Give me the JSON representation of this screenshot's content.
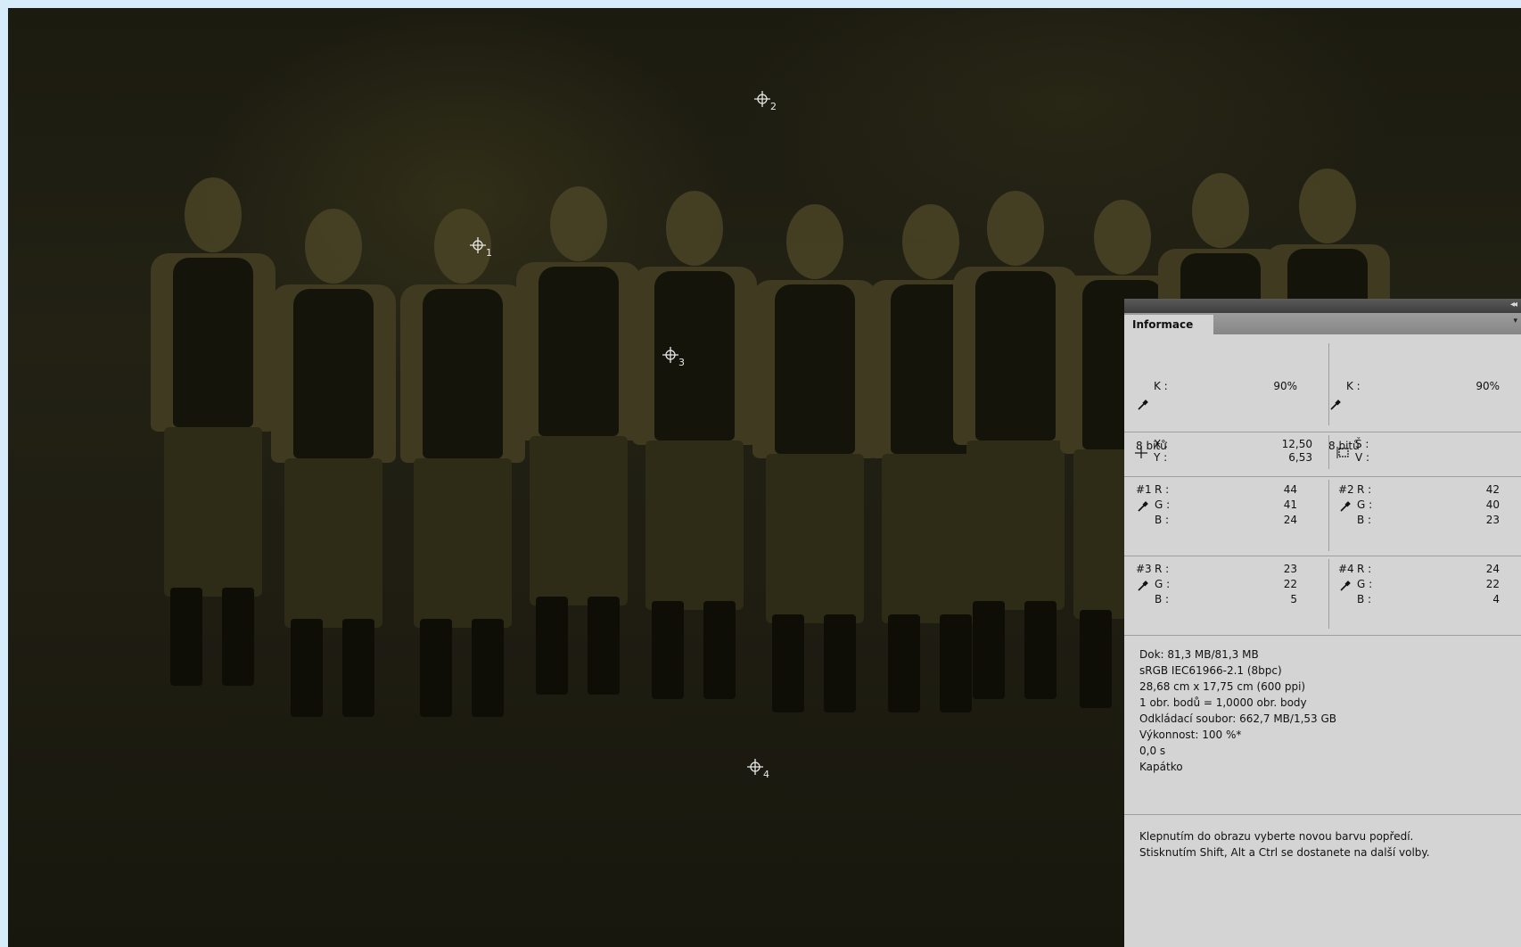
{
  "canvas": {
    "markers": [
      {
        "id": "1",
        "label": "1"
      },
      {
        "id": "2",
        "label": "2"
      },
      {
        "id": "3",
        "label": "3"
      },
      {
        "id": "4",
        "label": "4"
      }
    ]
  },
  "panel": {
    "tab_label": "Informace",
    "collapse_glyph": "◂◂",
    "menu_glyph": "▾",
    "k_left": {
      "label": "K :",
      "value": "90%",
      "bits": "8 bitů"
    },
    "k_right": {
      "label": "K :",
      "value": "90%",
      "bits": "8 bitů"
    },
    "coords": {
      "x_label": "X :",
      "y_label": "Y :",
      "x_value": "12,50",
      "y_value": "6,53",
      "w_label": "Š :",
      "h_label": "V :"
    },
    "samplers": [
      {
        "prefix": "#1",
        "r_label": "R :",
        "g_label": "G :",
        "b_label": "B :",
        "r": "44",
        "g": "41",
        "b": "24"
      },
      {
        "prefix": "#2",
        "r_label": "R :",
        "g_label": "G :",
        "b_label": "B :",
        "r": "42",
        "g": "40",
        "b": "23"
      },
      {
        "prefix": "#3",
        "r_label": "R :",
        "g_label": "G :",
        "b_label": "B :",
        "r": "23",
        "g": "22",
        "b": "5"
      },
      {
        "prefix": "#4",
        "r_label": "R :",
        "g_label": "G :",
        "b_label": "B :",
        "r": "24",
        "g": "22",
        "b": "4"
      }
    ],
    "doc_info": [
      "Dok: 81,3 MB/81,3 MB",
      "sRGB IEC61966-2.1 (8bpc)",
      "28,68 cm x 17,75 cm (600 ppi)",
      "1 obr. bodů = 1,0000 obr. body",
      "Odkládací soubor: 662,7 MB/1,53 GB",
      "Výkonnost: 100 %*",
      "0,0 s",
      "Kapátko"
    ],
    "hint": [
      "Klepnutím do obrazu vyberte novou barvu popředí.",
      "Stisknutím Shift, Alt a Ctrl se dostanete na další volby."
    ]
  },
  "colors": {
    "page_bg": "#d7ecfb",
    "panel_bg": "#d4d4d4",
    "marker": "#e8e8e8"
  }
}
